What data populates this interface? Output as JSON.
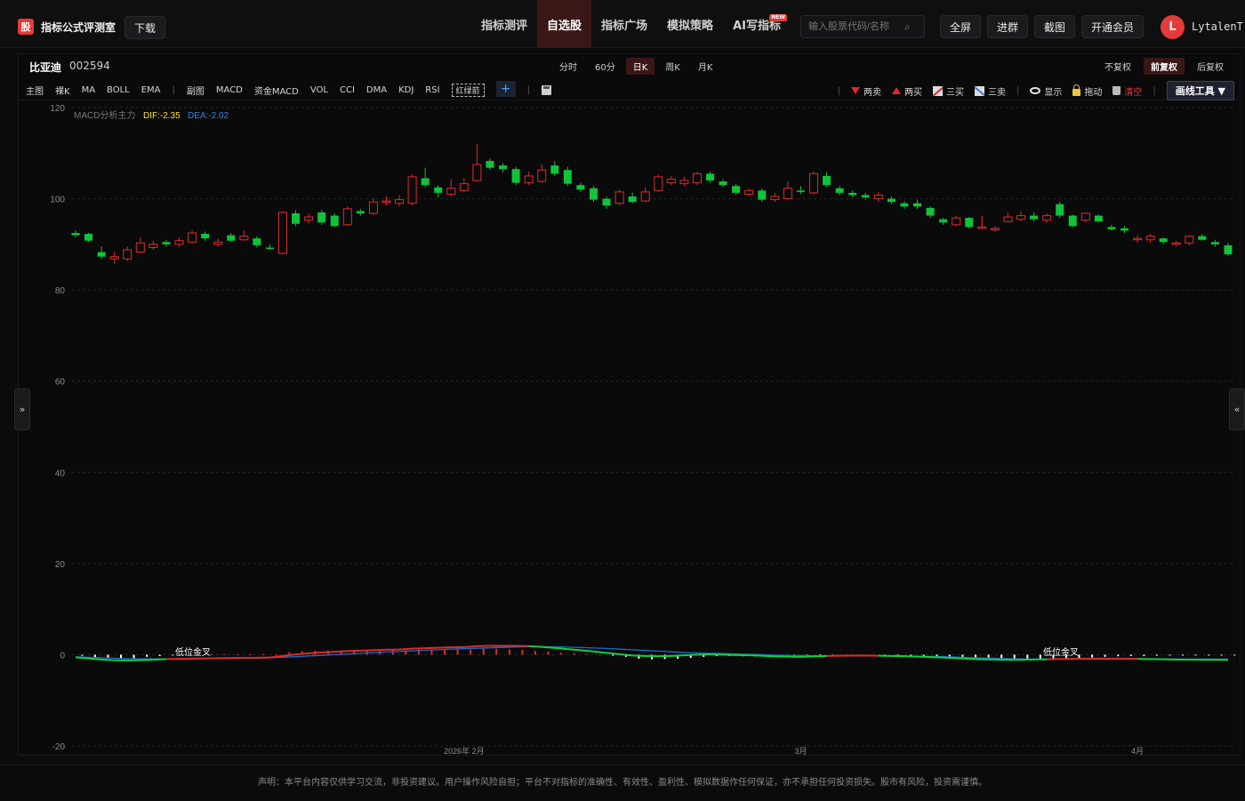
{
  "brand": {
    "logo": "股",
    "name": "指标公式评测室",
    "download": "下载"
  },
  "nav": [
    {
      "label": "指标测评",
      "active": false
    },
    {
      "label": "自选股",
      "active": true
    },
    {
      "label": "指标广场",
      "active": false
    },
    {
      "label": "模拟策略",
      "active": false
    },
    {
      "label": "AI写指标",
      "active": false,
      "badge": "NEW"
    }
  ],
  "search": {
    "placeholder": "输入股票代码/名称"
  },
  "top_buttons": {
    "fullscreen": "全屏",
    "join": "进群",
    "screenshot": "截图",
    "vip": "开通会员"
  },
  "user": {
    "initial": "L",
    "name": "LytalenT"
  },
  "stock": {
    "name": "比亚迪",
    "code": "002594"
  },
  "periods": [
    {
      "label": "分时",
      "active": false
    },
    {
      "label": "60分",
      "active": false
    },
    {
      "label": "日K",
      "active": true
    },
    {
      "label": "周K",
      "active": false
    },
    {
      "label": "月K",
      "active": false
    }
  ],
  "adjust": [
    {
      "label": "不复权",
      "active": false
    },
    {
      "label": "前复权",
      "active": true
    },
    {
      "label": "后复权",
      "active": false
    }
  ],
  "indicators_main": [
    "主图",
    "裸K",
    "MA",
    "BOLL",
    "EMA"
  ],
  "indicators_sub": [
    "副图",
    "MACD",
    "资金MACD",
    "VOL",
    "CCI",
    "DMA",
    "KDJ",
    "RSI"
  ],
  "indicator_highlight": "红绿箭",
  "add_label": "+",
  "tools": {
    "two_sell": "两卖",
    "two_buy": "两买",
    "three_buy": "三买",
    "three_sell": "三卖",
    "show": "显示",
    "drag": "拖动",
    "clear": "清空",
    "draw": "画线工具 ▼"
  },
  "legend": {
    "name": "MACD分析主力",
    "dif": "DIF:-2.35",
    "dea": "DEA:-2.02"
  },
  "signal_labels": [
    "低位金叉",
    "低位金叉"
  ],
  "panel_toggles": {
    "left": "»",
    "right": "«"
  },
  "colors": {
    "up": "#e02a2a",
    "down": "#10c43a",
    "dif": "#10d040",
    "dea": "#1c6cc8",
    "accent": "#e43a3a",
    "bg": "#0a0a0b"
  },
  "disclaimer": "声明：本平台内容仅供学习交流，非投资建议。用户操作风险自担；平台不对指标的准确性、有效性、盈利性、模拟数据作任何保证，亦不承担任何投资损失。股市有风险，投资需谨慎。",
  "chart_data": {
    "type": "candlestick",
    "ylim": [
      -20,
      120
    ],
    "yticks": [
      120,
      100,
      80,
      60,
      40,
      20,
      0,
      -20
    ],
    "x_labels": [
      "2026年 2月",
      "3月",
      "4月"
    ],
    "candles": [
      {
        "o": 92.5,
        "c": 92.0,
        "h": 93.0,
        "l": 91.5
      },
      {
        "o": 92.3,
        "c": 90.8,
        "h": 92.5,
        "l": 90.5
      },
      {
        "o": 88.3,
        "c": 87.3,
        "h": 89.5,
        "l": 86.8
      },
      {
        "o": 86.8,
        "c": 87.3,
        "h": 88.3,
        "l": 85.8
      },
      {
        "o": 86.8,
        "c": 88.8,
        "h": 89.5,
        "l": 86.3
      },
      {
        "o": 88.3,
        "c": 90.3,
        "h": 91.5,
        "l": 88.0
      },
      {
        "o": 89.3,
        "c": 90.0,
        "h": 90.8,
        "l": 88.8
      },
      {
        "o": 90.5,
        "c": 90.0,
        "h": 91.0,
        "l": 89.5
      },
      {
        "o": 90.0,
        "c": 90.8,
        "h": 91.5,
        "l": 89.5
      },
      {
        "o": 90.5,
        "c": 92.5,
        "h": 93.0,
        "l": 90.3
      },
      {
        "o": 92.3,
        "c": 91.3,
        "h": 92.8,
        "l": 90.8
      },
      {
        "o": 90.0,
        "c": 90.5,
        "h": 91.3,
        "l": 89.5
      },
      {
        "o": 92.0,
        "c": 90.8,
        "h": 92.5,
        "l": 90.5
      },
      {
        "o": 91.0,
        "c": 91.8,
        "h": 93.0,
        "l": 90.8
      },
      {
        "o": 91.3,
        "c": 89.8,
        "h": 91.8,
        "l": 89.3
      },
      {
        "o": 89.3,
        "c": 89.0,
        "h": 90.0,
        "l": 88.8
      },
      {
        "o": 88.0,
        "c": 97.0,
        "h": 97.3,
        "l": 87.8
      },
      {
        "o": 96.8,
        "c": 94.5,
        "h": 97.5,
        "l": 94.0
      },
      {
        "o": 95.3,
        "c": 96.0,
        "h": 96.8,
        "l": 94.5
      },
      {
        "o": 97.0,
        "c": 94.8,
        "h": 97.5,
        "l": 94.3
      },
      {
        "o": 96.3,
        "c": 94.0,
        "h": 96.8,
        "l": 93.8
      },
      {
        "o": 94.3,
        "c": 97.8,
        "h": 98.3,
        "l": 94.0
      },
      {
        "o": 97.3,
        "c": 96.8,
        "h": 97.8,
        "l": 96.3
      },
      {
        "o": 96.8,
        "c": 99.3,
        "h": 100.0,
        "l": 96.5
      },
      {
        "o": 99.3,
        "c": 99.5,
        "h": 100.5,
        "l": 98.5
      },
      {
        "o": 99.0,
        "c": 99.8,
        "h": 100.8,
        "l": 98.3
      },
      {
        "o": 99.0,
        "c": 104.8,
        "h": 105.3,
        "l": 98.5
      },
      {
        "o": 104.5,
        "c": 103.0,
        "h": 106.8,
        "l": 102.5
      },
      {
        "o": 102.5,
        "c": 101.3,
        "h": 103.0,
        "l": 100.3
      },
      {
        "o": 101.0,
        "c": 102.3,
        "h": 104.3,
        "l": 100.5
      },
      {
        "o": 101.8,
        "c": 103.3,
        "h": 104.5,
        "l": 101.5
      },
      {
        "o": 104.0,
        "c": 107.5,
        "h": 112.0,
        "l": 103.8
      },
      {
        "o": 108.3,
        "c": 106.8,
        "h": 108.8,
        "l": 106.3
      },
      {
        "o": 107.3,
        "c": 106.5,
        "h": 107.8,
        "l": 105.8
      },
      {
        "o": 106.5,
        "c": 103.5,
        "h": 107.0,
        "l": 103.0
      },
      {
        "o": 103.5,
        "c": 105.0,
        "h": 106.0,
        "l": 103.0
      },
      {
        "o": 103.8,
        "c": 106.3,
        "h": 107.5,
        "l": 103.5
      },
      {
        "o": 107.3,
        "c": 105.5,
        "h": 108.3,
        "l": 105.0
      },
      {
        "o": 106.3,
        "c": 103.3,
        "h": 107.0,
        "l": 102.8
      },
      {
        "o": 103.0,
        "c": 102.0,
        "h": 103.5,
        "l": 101.5
      },
      {
        "o": 102.3,
        "c": 99.8,
        "h": 102.8,
        "l": 99.3
      },
      {
        "o": 100.0,
        "c": 98.5,
        "h": 100.5,
        "l": 97.8
      },
      {
        "o": 99.0,
        "c": 101.5,
        "h": 102.0,
        "l": 98.5
      },
      {
        "o": 100.5,
        "c": 99.3,
        "h": 101.3,
        "l": 99.0
      },
      {
        "o": 99.5,
        "c": 101.5,
        "h": 102.5,
        "l": 99.3
      },
      {
        "o": 101.8,
        "c": 104.8,
        "h": 105.3,
        "l": 101.5
      },
      {
        "o": 103.5,
        "c": 104.3,
        "h": 105.0,
        "l": 103.0
      },
      {
        "o": 103.3,
        "c": 104.0,
        "h": 104.8,
        "l": 102.8
      },
      {
        "o": 103.5,
        "c": 105.5,
        "h": 106.0,
        "l": 103.0
      },
      {
        "o": 105.5,
        "c": 104.0,
        "h": 106.0,
        "l": 103.5
      },
      {
        "o": 103.8,
        "c": 103.0,
        "h": 104.3,
        "l": 102.5
      },
      {
        "o": 102.8,
        "c": 101.3,
        "h": 103.3,
        "l": 100.8
      },
      {
        "o": 101.0,
        "c": 101.8,
        "h": 102.3,
        "l": 100.5
      },
      {
        "o": 101.8,
        "c": 99.8,
        "h": 102.3,
        "l": 99.3
      },
      {
        "o": 99.8,
        "c": 100.5,
        "h": 101.3,
        "l": 99.3
      },
      {
        "o": 100.0,
        "c": 102.3,
        "h": 103.8,
        "l": 99.8
      },
      {
        "o": 101.8,
        "c": 101.5,
        "h": 102.8,
        "l": 101.0
      },
      {
        "o": 101.3,
        "c": 105.5,
        "h": 106.0,
        "l": 101.0
      },
      {
        "o": 105.0,
        "c": 103.0,
        "h": 105.8,
        "l": 102.5
      },
      {
        "o": 102.3,
        "c": 101.3,
        "h": 102.8,
        "l": 100.8
      },
      {
        "o": 101.3,
        "c": 100.8,
        "h": 101.8,
        "l": 100.3
      },
      {
        "o": 100.8,
        "c": 100.3,
        "h": 101.3,
        "l": 99.8
      },
      {
        "o": 100.0,
        "c": 100.8,
        "h": 101.5,
        "l": 99.3
      },
      {
        "o": 100.0,
        "c": 99.3,
        "h": 100.5,
        "l": 98.8
      },
      {
        "o": 99.0,
        "c": 98.3,
        "h": 99.5,
        "l": 97.8
      },
      {
        "o": 99.0,
        "c": 98.3,
        "h": 99.8,
        "l": 97.8
      },
      {
        "o": 98.0,
        "c": 96.3,
        "h": 98.3,
        "l": 95.8
      },
      {
        "o": 95.5,
        "c": 94.8,
        "h": 95.8,
        "l": 94.3
      },
      {
        "o": 94.3,
        "c": 95.8,
        "h": 96.3,
        "l": 94.0
      },
      {
        "o": 95.8,
        "c": 93.8,
        "h": 96.0,
        "l": 93.5
      },
      {
        "o": 93.5,
        "c": 93.8,
        "h": 96.3,
        "l": 93.3
      },
      {
        "o": 93.3,
        "c": 93.5,
        "h": 94.0,
        "l": 92.8
      },
      {
        "o": 95.0,
        "c": 96.0,
        "h": 97.0,
        "l": 94.8
      },
      {
        "o": 95.5,
        "c": 96.3,
        "h": 97.3,
        "l": 95.0
      },
      {
        "o": 96.3,
        "c": 95.5,
        "h": 97.0,
        "l": 95.0
      },
      {
        "o": 95.3,
        "c": 96.3,
        "h": 96.8,
        "l": 94.8
      },
      {
        "o": 98.8,
        "c": 96.3,
        "h": 99.3,
        "l": 95.8
      },
      {
        "o": 96.3,
        "c": 94.0,
        "h": 96.5,
        "l": 93.8
      },
      {
        "o": 95.3,
        "c": 96.8,
        "h": 97.0,
        "l": 94.8
      },
      {
        "o": 96.3,
        "c": 95.0,
        "h": 96.5,
        "l": 94.8
      },
      {
        "o": 93.8,
        "c": 93.3,
        "h": 94.3,
        "l": 93.0
      },
      {
        "o": 93.5,
        "c": 93.0,
        "h": 94.0,
        "l": 92.5
      },
      {
        "o": 91.3,
        "c": 91.3,
        "h": 92.0,
        "l": 90.3
      },
      {
        "o": 91.0,
        "c": 91.8,
        "h": 92.3,
        "l": 90.3
      },
      {
        "o": 91.3,
        "c": 90.5,
        "h": 91.5,
        "l": 90.0
      },
      {
        "o": 90.3,
        "c": 90.3,
        "h": 90.8,
        "l": 89.5
      },
      {
        "o": 90.3,
        "c": 91.8,
        "h": 92.0,
        "l": 89.8
      },
      {
        "o": 91.8,
        "c": 91.0,
        "h": 92.3,
        "l": 90.8
      },
      {
        "o": 90.5,
        "c": 90.0,
        "h": 91.0,
        "l": 89.5
      },
      {
        "o": 89.8,
        "c": 87.8,
        "h": 90.3,
        "l": 87.5
      }
    ],
    "macd_hist": [
      -0.4,
      -0.9,
      -1.2,
      -1.5,
      -1.3,
      -0.8,
      -0.5,
      -0.2,
      0.1,
      0.2,
      0.3,
      0.3,
      0.2,
      0.2,
      0.2,
      0.1,
      0.9,
      1.3,
      1.5,
      1.5,
      1.5,
      1.6,
      1.6,
      1.7,
      1.8,
      1.7,
      1.9,
      2.0,
      2.0,
      2.0,
      1.9,
      2.3,
      2.2,
      2.0,
      1.8,
      1.4,
      1.2,
      0.8,
      0.6,
      0.3,
      0.0,
      -0.4,
      -0.8,
      -1.5,
      -1.7,
      -1.6,
      -1.5,
      -1.2,
      -0.8,
      -0.5,
      -0.5,
      -0.6,
      -0.7,
      -0.8,
      -0.9,
      -0.9,
      -1.0,
      -0.8,
      -0.5,
      -0.3,
      -0.3,
      -0.4,
      -0.4,
      -0.5,
      -0.6,
      -0.6,
      -0.7,
      -0.8,
      -0.9,
      -1.0,
      -1.1,
      -1.3,
      -1.5,
      -1.6,
      -1.5,
      -1.4,
      -1.3,
      -1.2,
      -1.0,
      -0.8,
      -0.6,
      -0.5,
      -0.5,
      -0.4,
      -0.3,
      -0.3,
      -0.2,
      -0.2,
      -0.1,
      -0.1
    ],
    "dif": [
      -1.2,
      -1.7,
      -2.2,
      -2.5,
      -2.6,
      -2.5,
      -2.3,
      -2.0,
      -1.9,
      -1.8,
      -1.7,
      -1.6,
      -1.5,
      -1.4,
      -1.4,
      -1.3,
      -0.6,
      0.1,
      0.6,
      1.0,
      1.3,
      1.6,
      1.8,
      2.0,
      2.2,
      2.3,
      2.7,
      2.9,
      3.1,
      3.3,
      3.4,
      3.8,
      4.0,
      4.0,
      4.0,
      3.8,
      3.5,
      3.0,
      2.5,
      2.0,
      1.4,
      0.8,
      0.2,
      -0.4,
      -0.6,
      -0.7,
      -0.6,
      -0.3,
      0.0,
      0.2,
      0.0,
      -0.2,
      -0.3,
      -0.5,
      -0.8,
      -0.9,
      -1.0,
      -0.8,
      -0.6,
      -0.5,
      -0.4,
      -0.4,
      -0.5,
      -0.6,
      -0.7,
      -0.9,
      -1.1,
      -1.3,
      -1.6,
      -1.9,
      -2.1,
      -2.2,
      -2.3,
      -2.3,
      -2.2,
      -2.1,
      -2.0,
      -1.9,
      -1.8,
      -1.8,
      -1.8,
      -1.8,
      -1.9,
      -2.0,
      -2.1,
      -2.2,
      -2.2,
      -2.3,
      -2.3,
      -2.35
    ],
    "dea": [
      -1.0,
      -1.2,
      -1.4,
      -1.6,
      -1.8,
      -1.9,
      -1.9,
      -1.9,
      -1.9,
      -1.9,
      -1.8,
      -1.8,
      -1.7,
      -1.6,
      -1.5,
      -1.4,
      -1.2,
      -0.9,
      -0.6,
      -0.3,
      0.0,
      0.3,
      0.6,
      0.9,
      1.2,
      1.4,
      1.7,
      2.0,
      2.2,
      2.5,
      2.7,
      2.9,
      3.1,
      3.3,
      3.5,
      3.6,
      3.6,
      3.5,
      3.4,
      3.2,
      3.0,
      2.8,
      2.5,
      2.2,
      1.9,
      1.6,
      1.3,
      1.0,
      0.8,
      0.6,
      0.5,
      0.3,
      0.2,
      0.0,
      -0.2,
      -0.3,
      -0.4,
      -0.5,
      -0.5,
      -0.5,
      -0.5,
      -0.5,
      -0.5,
      -0.5,
      -0.6,
      -0.7,
      -0.8,
      -0.9,
      -1.1,
      -1.3,
      -1.5,
      -1.6,
      -1.8,
      -1.9,
      -2.0,
      -2.0,
      -2.0,
      -2.0,
      -2.0,
      -1.9,
      -1.9,
      -1.9,
      -1.9,
      -1.9,
      -2.0,
      -2.0,
      -2.0,
      -2.0,
      -2.0,
      -2.02
    ]
  }
}
